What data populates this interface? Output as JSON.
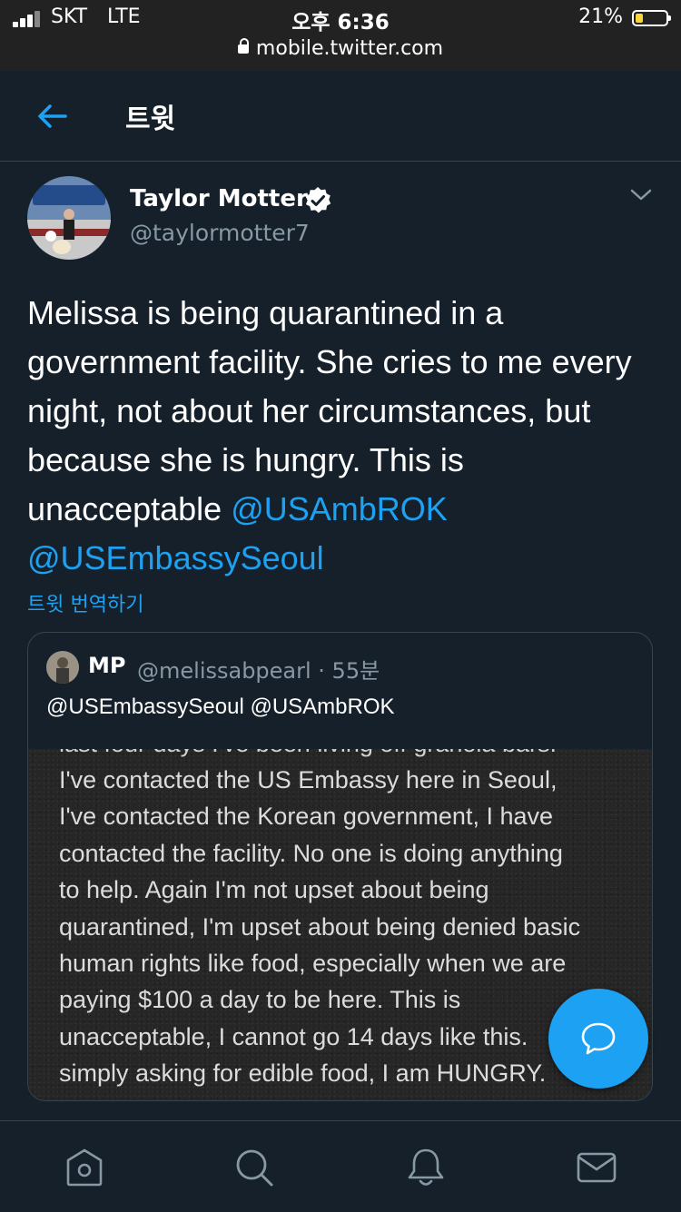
{
  "status_bar": {
    "carrier": "SKT",
    "network": "LTE",
    "time": "오후 6:36",
    "url": "mobile.twitter.com",
    "battery_percent": "21%"
  },
  "header": {
    "title": "트윗",
    "back_icon": "arrow-left-icon"
  },
  "tweet": {
    "author_name": "Taylor Motter",
    "author_handle": "@taylormotter7",
    "verified": true,
    "text_parts": [
      "Melissa is being quarantined in a government facility. She cries to me every night, not about her circumstances, but because she is hungry. This is unacceptable ",
      "@USAmbROK",
      " ",
      "@USEmbassySeoul"
    ],
    "translate_label": "트윗 번역하기"
  },
  "quoted_tweet": {
    "name": "MP",
    "handle_time": "@melissabpearl · 55분",
    "text": "@USEmbassySeoul @USAmbROK",
    "image_text_cut": "last four days I've been living off granola bars.",
    "image_text_lines": [
      "I've contacted the US Embassy here in Seoul,",
      "I've contacted the Korean government, I have",
      "contacted the facility. No one is doing anything",
      "to help. Again I'm not upset about being",
      "quarantined, I'm upset about being denied basic",
      "human rights like food, especially when we are",
      "paying $100 a day to be here. This is",
      "unacceptable, I cannot go 14 days like this.",
      "simply asking for edible food, I am HUNGRY."
    ]
  },
  "tabbar": {
    "items": [
      "home-icon",
      "search-icon",
      "notifications-icon",
      "messages-icon"
    ]
  },
  "colors": {
    "background": "#15202b",
    "accent": "#1da1f2",
    "secondary_text": "#8899a6",
    "border": "#38444d",
    "status_bar": "#222222"
  }
}
